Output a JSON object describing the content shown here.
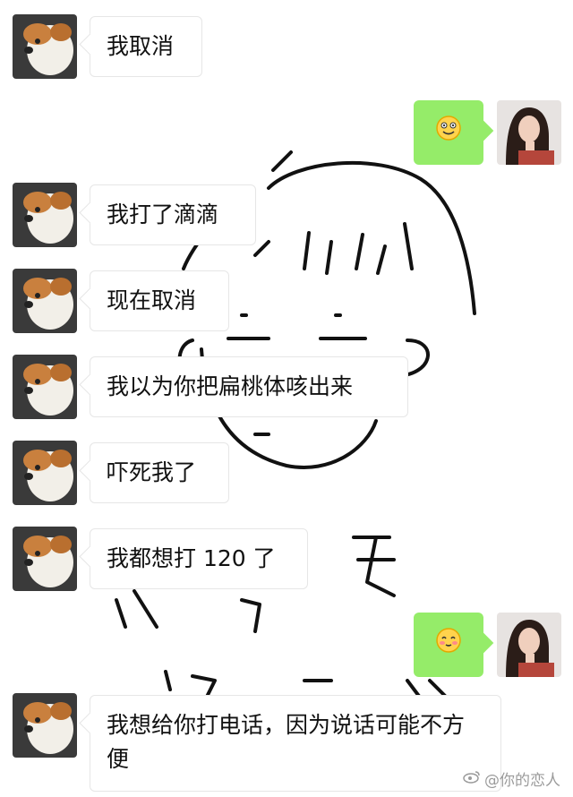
{
  "messages": [
    {
      "side": "left",
      "text": "我取消"
    },
    {
      "side": "right",
      "emoji": "smile-emoji"
    },
    {
      "side": "left",
      "text": "我打了滴滴"
    },
    {
      "side": "left",
      "text": "现在取消"
    },
    {
      "side": "left",
      "text": "我以为你把扁桃体咳出来"
    },
    {
      "side": "left",
      "text": "吓死我了"
    },
    {
      "side": "left",
      "text": "我都想打 120 了"
    },
    {
      "side": "right",
      "emoji": "blush-emoji"
    },
    {
      "side": "left",
      "text": "我想给你打电话，因为说话可能不方便"
    }
  ],
  "watermark": {
    "text": "@你的恋人"
  },
  "colors": {
    "right_bubble": "#95ec69",
    "left_bubble": "#ffffff",
    "background": "#ffffff"
  }
}
